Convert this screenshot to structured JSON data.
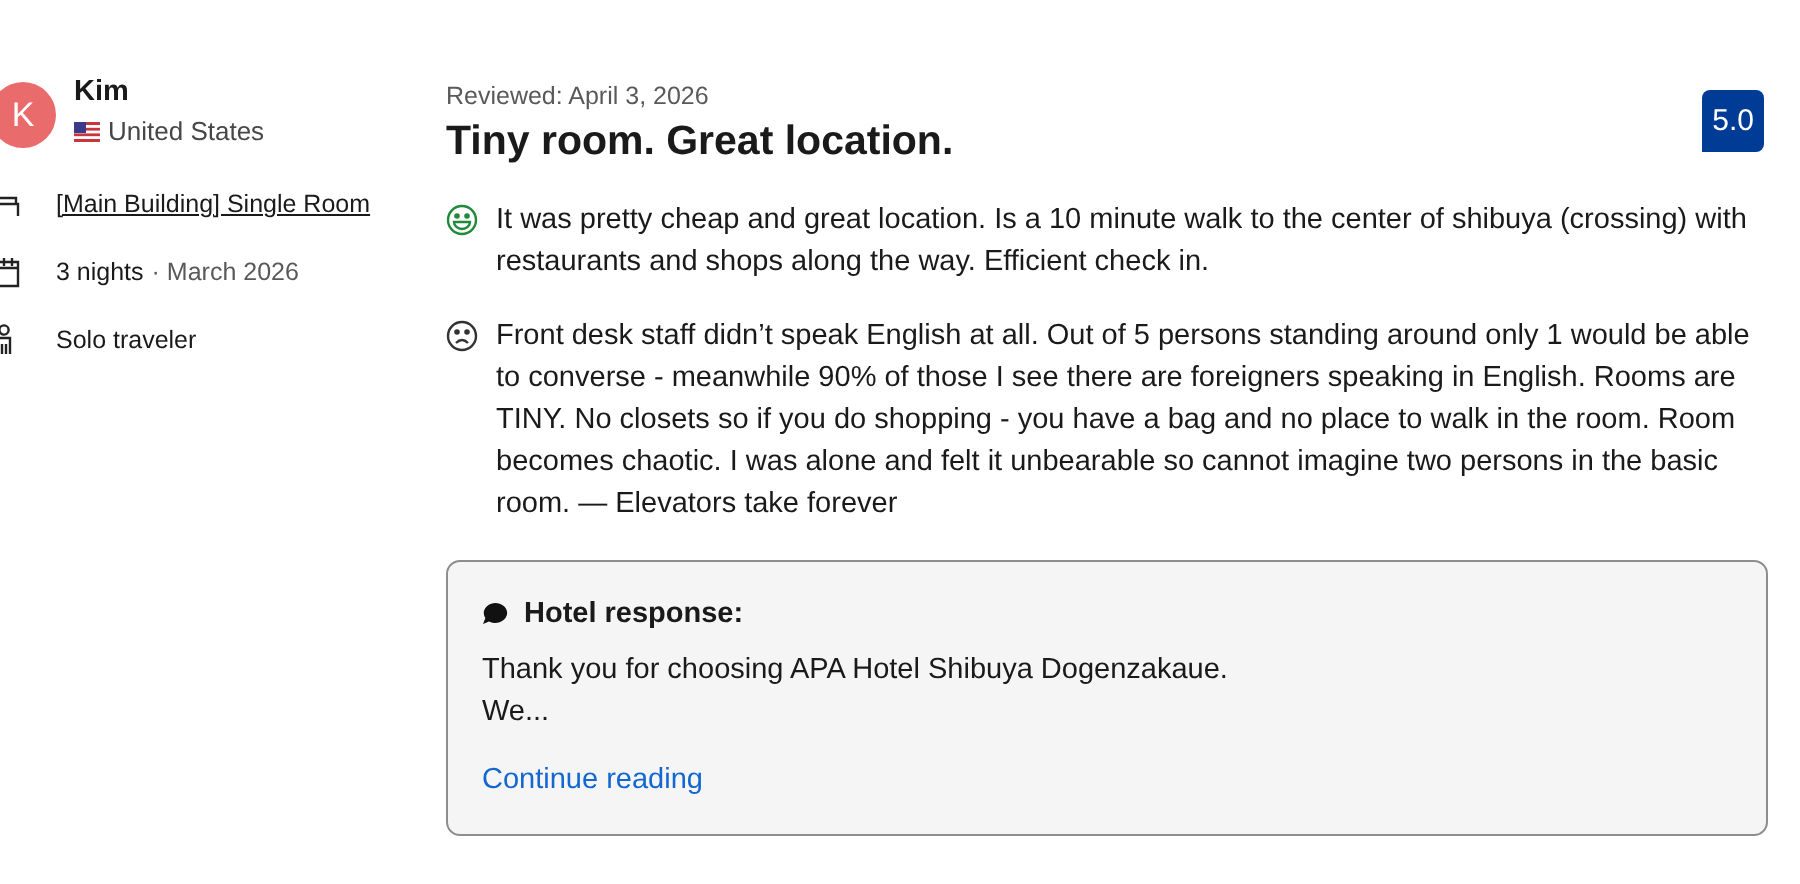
{
  "reviewer": {
    "initial": "K",
    "name": "Kim",
    "country": "United States"
  },
  "details": [
    {
      "kind": "room",
      "text": "[Main Building] Single Room"
    },
    {
      "kind": "stay",
      "text": "3 nights",
      "extra": "· March 2026"
    },
    {
      "kind": "traveler",
      "text": "Solo traveler"
    }
  ],
  "review": {
    "date": "Reviewed: April 3, 2026",
    "title": "Tiny room. Great location.",
    "score": "5.0",
    "comments": [
      {
        "kind": "positive",
        "text": "It was pretty cheap and great location. Is a 10 minute walk to the center of shibuya (crossing) with restaurants and shops along the way. Efficient check in."
      },
      {
        "kind": "negative",
        "text": "Front desk staff didn’t speak English at all. Out of 5 persons standing around only 1 would be able to converse - meanwhile 90% of those I see there are foreigners speaking in English. Rooms are TINY. No closets so if you do shopping - you have a bag and no place to walk in the room. Room becomes chaotic. I was alone and felt it unbearable so cannot imagine two persons in the basic room. — Elevators take forever"
      }
    ]
  },
  "response": {
    "heading": "Hotel response:",
    "text": "Thank you for choosing APA Hotel Shibuya Dogenzakaue.\nWe...",
    "link": "Continue reading"
  }
}
